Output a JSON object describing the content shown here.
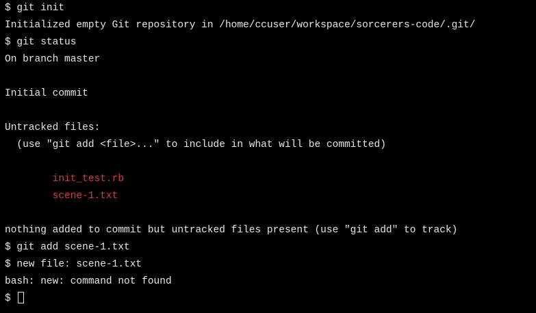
{
  "colors": {
    "background": "#000000",
    "text": "#e6e6e6",
    "untracked": "#d23f3f"
  },
  "lines": [
    "$ git init",
    "Initialized empty Git repository in /home/ccuser/workspace/sorcerers-code/.git/",
    "$ git status",
    "On branch master",
    "",
    "Initial commit",
    "",
    "Untracked files:",
    "  (use \"git add <file>...\" to include in what will be committed)",
    "",
    "        init_test.rb",
    "        scene-1.txt",
    "",
    "nothing added to commit but untracked files present (use \"git add\" to track)",
    "$ git add scene-1.txt",
    "$ new file: scene-1.txt",
    "bash: new: command not found"
  ],
  "prompt": "$ "
}
